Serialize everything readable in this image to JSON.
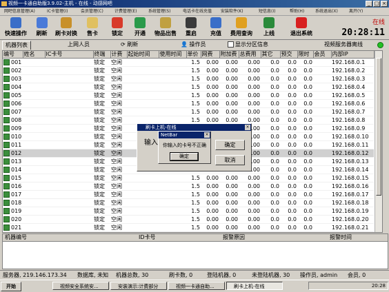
{
  "window": {
    "title": "视频一卡通自助版3.9.02-主机 - 在线 - 动感网吧"
  },
  "menu": [
    "网吧信息管理(A)",
    "IC卡管理(I)",
    "会员管理(C)",
    "计费管理(E)",
    "系统管理(S)",
    "电话卡在线充值",
    "安装软件(K)",
    "短信息(I)",
    "帮助(H)",
    "系统退出(X)",
    "离开(Y)"
  ],
  "toolbar": {
    "buttons": [
      {
        "label": "快速操作",
        "color": "#3a6ec8"
      },
      {
        "label": "刷新",
        "color": "#4a7ad8"
      },
      {
        "label": "刷卡对换",
        "color": "#c8902a"
      },
      {
        "label": "售卡",
        "color": "#e0c060"
      },
      {
        "label": "锁定",
        "color": "#d83a2a"
      },
      {
        "label": "开通",
        "color": "#2a9a4a"
      },
      {
        "label": "物品出售",
        "color": "#c0a040"
      },
      {
        "label": "重启",
        "color": "#3a3a3a"
      },
      {
        "label": "充值",
        "color": "#3a6ec8"
      },
      {
        "label": "费用查询",
        "color": "#e0a020"
      },
      {
        "label": "上线",
        "color": "#2a8a3a"
      },
      {
        "label": "退出系统",
        "color": "#d82020"
      }
    ],
    "status": "在线",
    "clock": "20:28:11"
  },
  "tabs": {
    "machine_list": "机器列表",
    "online_users": "上网人员",
    "refresh": "刷新",
    "operators": "操作员",
    "show_partition": "显示分区信息",
    "video_server": "视频服务器离线"
  },
  "grid": {
    "columns": [
      "编号",
      "姓名",
      "IC卡号",
      "终端",
      "计费",
      "起始时间",
      "使用时间",
      "单价",
      "网费",
      "附加费",
      "总费用",
      "其它",
      "预交",
      "限时",
      "会员",
      "内部IP"
    ],
    "rows": [
      {
        "id": "001",
        "ip": "192.168.0.1"
      },
      {
        "id": "002",
        "ip": "192.168.0.2"
      },
      {
        "id": "003",
        "ip": "192.168.0.3"
      },
      {
        "id": "004",
        "ip": "192.168.0.4"
      },
      {
        "id": "005",
        "ip": "192.168.0.5"
      },
      {
        "id": "006",
        "ip": "192.168.0.6"
      },
      {
        "id": "007",
        "ip": "192.168.0.7"
      },
      {
        "id": "008",
        "ip": "192.168.0.8"
      },
      {
        "id": "009",
        "ip": "192.168.0.9"
      },
      {
        "id": "010",
        "ip": "192.168.0.10"
      },
      {
        "id": "011",
        "ip": "192.168.0.11"
      },
      {
        "id": "012",
        "ip": "192.168.0.12"
      },
      {
        "id": "013",
        "ip": "192.168.0.13"
      },
      {
        "id": "014",
        "ip": "192.168.0.14"
      },
      {
        "id": "015",
        "ip": "192.168.0.15"
      },
      {
        "id": "016",
        "ip": "192.168.0.16"
      },
      {
        "id": "017",
        "ip": "192.168.0.17"
      },
      {
        "id": "018",
        "ip": "192.168.0.18"
      },
      {
        "id": "019",
        "ip": "192.168.0.19"
      },
      {
        "id": "020",
        "ip": "192.168.0.20"
      },
      {
        "id": "021",
        "ip": "192.168.0.21"
      }
    ],
    "terminal_state": "锁定",
    "billing_state": "空闲",
    "price": "1.5",
    "zero": "0.00",
    "zero_short": "0.0",
    "selected_id": "012"
  },
  "dialog_back": {
    "title": "刷卡上机-在线",
    "prompt": "输入",
    "ok": "确定",
    "cancel": "取消"
  },
  "dialog_msg": {
    "title": "NetBar",
    "message": "你输入的卡号不正确",
    "ok": "确定"
  },
  "alarm": {
    "columns": [
      "机器编号",
      "ID卡号",
      "报警原因",
      "报警时间"
    ]
  },
  "status": {
    "server": "服务器, 219.146.173.34",
    "db": "数据库, 未知",
    "total": "机器总数, 30",
    "cards": "刷卡数, 0",
    "logged": "登陆机器, 0",
    "notlogged": "未登陆机器, 30",
    "operator": "操作员, admin",
    "members": "会员, 0"
  },
  "taskbar": {
    "start": "开始",
    "tasks": [
      "视频安全系统安...",
      "安装演示:计费部分",
      "视频一卡通自助...",
      "刷卡上机-在线"
    ],
    "time": "20:28"
  }
}
